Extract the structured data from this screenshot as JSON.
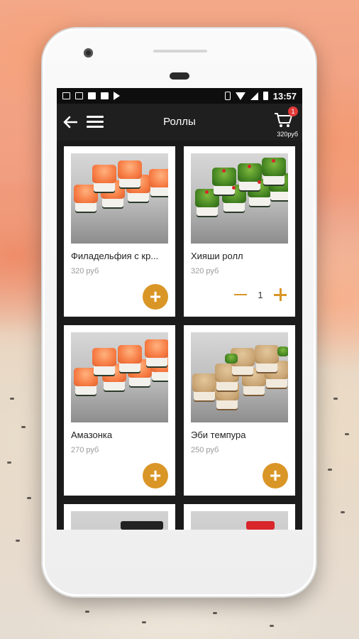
{
  "statusbar": {
    "time": "13:57"
  },
  "appbar": {
    "title": "Роллы",
    "cart_badge": "1",
    "cart_total": "320руб"
  },
  "products": [
    {
      "name": "Филадельфия с кр...",
      "price": "320 руб",
      "control": "add"
    },
    {
      "name": "Хияши ролл",
      "price": "320 руб",
      "control": "qty",
      "quantity": "1"
    },
    {
      "name": "Амазонка",
      "price": "270 руб",
      "control": "add"
    },
    {
      "name": "Эби темпура",
      "price": "250 руб",
      "control": "add"
    }
  ],
  "icons": {
    "back": "arrow-left-icon",
    "menu": "hamburger-icon",
    "cart": "cart-icon",
    "add": "plus-icon"
  },
  "colors": {
    "accent": "#d99627",
    "badge": "#e23a3a",
    "appbar": "#1f1f1f"
  }
}
